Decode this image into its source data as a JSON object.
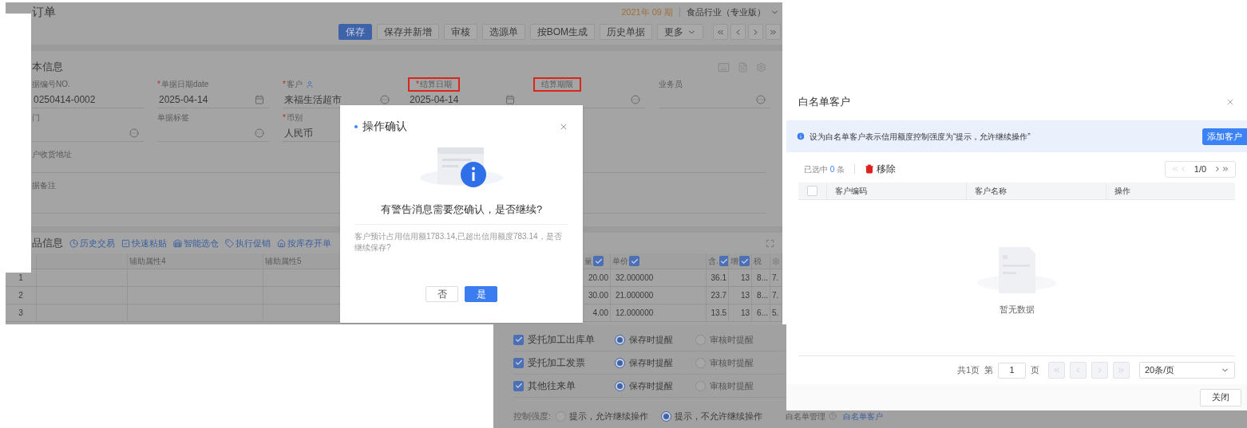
{
  "form": {
    "title": "订单",
    "period": "2021年 09 期",
    "org": "食品行业（专业版）",
    "toolbar": [
      {
        "label": "保存",
        "primary": true,
        "kind": "button"
      },
      {
        "label": "保存并新增",
        "primary": false,
        "kind": "button"
      },
      {
        "label": "审核",
        "primary": false,
        "kind": "button"
      },
      {
        "label": "选源单",
        "primary": false,
        "kind": "button"
      },
      {
        "label": "按BOM生成",
        "primary": false,
        "kind": "button"
      },
      {
        "label": "历史单据",
        "primary": false,
        "kind": "button"
      },
      {
        "label": "更多",
        "primary": false,
        "kind": "dropdown"
      }
    ],
    "basic_title": "本信息",
    "field_rows": [
      [
        {
          "kind": "text",
          "label": "据编号NO.",
          "highlighted": false,
          "value": "0250414-0002"
        },
        {
          "kind": "date",
          "required_mark": "*",
          "label": "单据日期date",
          "highlighted": false,
          "value": "2025-04-14"
        },
        {
          "kind": "customer",
          "required_mark": "*",
          "label": "客户",
          "highlighted": false,
          "value": "来福生活超市"
        },
        {
          "kind": "date",
          "required_mark": "*",
          "label": "结算日期",
          "highlighted": true,
          "value": "2025-04-14"
        },
        {
          "kind": "lookup",
          "label": "结算期限",
          "highlighted": true
        },
        {
          "kind": "lookup",
          "label": "业务员",
          "highlighted": false
        }
      ],
      [
        {
          "kind": "lookup",
          "label": "门",
          "highlighted": false
        },
        {
          "kind": "lookup",
          "label": "单据标签",
          "highlighted": false
        },
        {
          "kind": "lookup",
          "required_mark": "*",
          "label": "币别",
          "highlighted": false,
          "value": "人民币"
        }
      ]
    ],
    "address_label": "户收货地址",
    "remark_label": "据备注",
    "goods_title": "品信息",
    "actions": [
      {
        "label": "历史交易"
      },
      {
        "label": "快速粘贴"
      },
      {
        "label": "智能选仓"
      },
      {
        "label": "执行促销"
      },
      {
        "label": "按库存开单"
      }
    ],
    "side_headers": [
      "辅助属性4",
      "辅助属性5"
    ],
    "columns": [
      {
        "label": "量",
        "kind": "checkbox",
        "checked": true
      },
      {
        "label": "单价",
        "kind": "checkbox",
        "checked": true
      },
      {
        "label": "含.",
        "kind": "checkbox",
        "checked": true
      },
      {
        "label": "增",
        "kind": "checkbox",
        "checked": true
      },
      {
        "label": "税",
        "kind": "plain"
      }
    ],
    "rows": [
      {
        "number": "1",
        "cells": [
          "20.00",
          "32.000000",
          "36.1",
          "13",
          "8...",
          "7."
        ]
      },
      {
        "number": "2",
        "cells": [
          "30.00",
          "21.000000",
          "23.7",
          "13",
          "8...",
          "7."
        ]
      },
      {
        "number": "3",
        "cells": [
          "4.00",
          "12.000000",
          "13.5",
          "13",
          "6...",
          "5."
        ]
      }
    ]
  },
  "confirm": {
    "title": "操作确认",
    "message": "有警告消息需要您确认，是否继续?",
    "detail": "客户预计占用信用额1783.14,已超出信用额度783.14，是否继续保存?",
    "buttons": [
      {
        "label": "否",
        "primary": false
      },
      {
        "label": "是",
        "primary": true
      }
    ]
  },
  "settings": {
    "rows": [
      {
        "label": "受托加工出库单",
        "checked": true,
        "options": [
          {
            "label": "保存时提醒",
            "selected": true
          },
          {
            "label": "审核时提醒",
            "selected": false
          }
        ]
      },
      {
        "label": "受托加工发票",
        "checked": true,
        "options": [
          {
            "label": "保存时提醒",
            "selected": true
          },
          {
            "label": "审核时提醒",
            "selected": false
          }
        ]
      },
      {
        "label": "其他往来单",
        "checked": true,
        "options": [
          {
            "label": "保存时提醒",
            "selected": true
          },
          {
            "label": "审核时提醒",
            "selected": false
          }
        ]
      }
    ],
    "strength_label": "控制强度:",
    "strength_options": [
      {
        "label": "提示，允许继续操作",
        "selected": false
      },
      {
        "label": "提示，不允许继续操作",
        "selected": true
      }
    ],
    "whitelist_label": "白名单管理",
    "whitelist_link": "白名单客户"
  },
  "whitelist": {
    "title": "白名单客户",
    "notice": "设为白名单客户表示信用额度控制强度为“提示，允许继续操作”",
    "add_button": "添加客户",
    "selected_prefix": "已选中",
    "selected_count": "0",
    "selected_suffix": "条",
    "remove": "移除",
    "page_indicator": "1/0",
    "select_all_checked": false,
    "columns": [
      "客户编码",
      "客户名称",
      "操作"
    ],
    "empty": "暂无数据",
    "pager": {
      "total": "共1页",
      "page_prefix": "第",
      "page": "1",
      "page_suffix": "页",
      "page_size": "20条/页"
    },
    "close": "关闭"
  }
}
